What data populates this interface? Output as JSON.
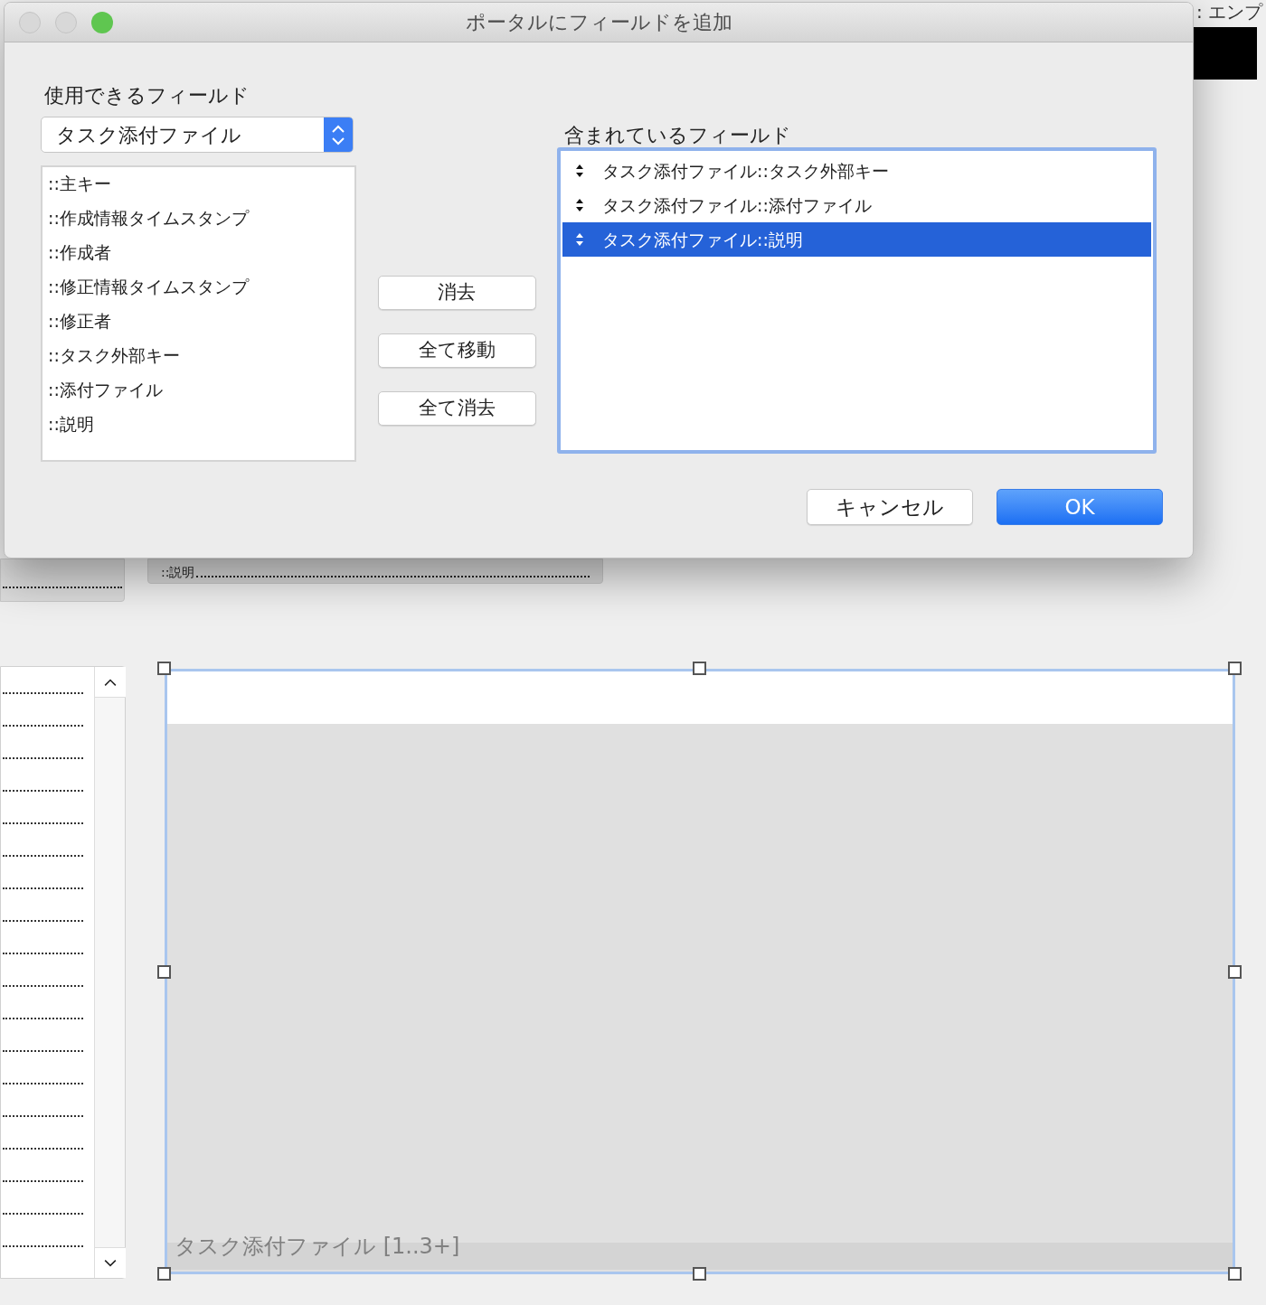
{
  "background": {
    "corner_text": ": エンプ",
    "field_label": "::説明",
    "portal": {
      "label": "タスク添付ファイル [1..3+]"
    }
  },
  "window": {
    "title": "ポータルにフィールドを追加",
    "traffic_lights": [
      {
        "kind": "close",
        "enabled": false
      },
      {
        "kind": "minimize",
        "enabled": false
      },
      {
        "kind": "zoom",
        "enabled": true
      }
    ]
  },
  "available": {
    "label": "使用できるフィールド",
    "table_popup": {
      "value": "タスク添付ファイル"
    },
    "fields": [
      "::主キー",
      "::作成情報タイムスタンプ",
      "::作成者",
      "::修正情報タイムスタンプ",
      "::修正者",
      "::タスク外部キー",
      "::添付ファイル",
      "::説明"
    ]
  },
  "move_buttons": [
    "消去",
    "全て移動",
    "全て消去"
  ],
  "included": {
    "label": "含まれているフィールド",
    "fields": [
      {
        "name": "タスク添付ファイル::タスク外部キー",
        "selected": false
      },
      {
        "name": "タスク添付ファイル::添付ファイル",
        "selected": false
      },
      {
        "name": "タスク添付ファイル::説明",
        "selected": true
      }
    ]
  },
  "footer_buttons": [
    {
      "label": "キャンセル",
      "kind": "secondary"
    },
    {
      "label": "OK",
      "kind": "default"
    }
  ]
}
